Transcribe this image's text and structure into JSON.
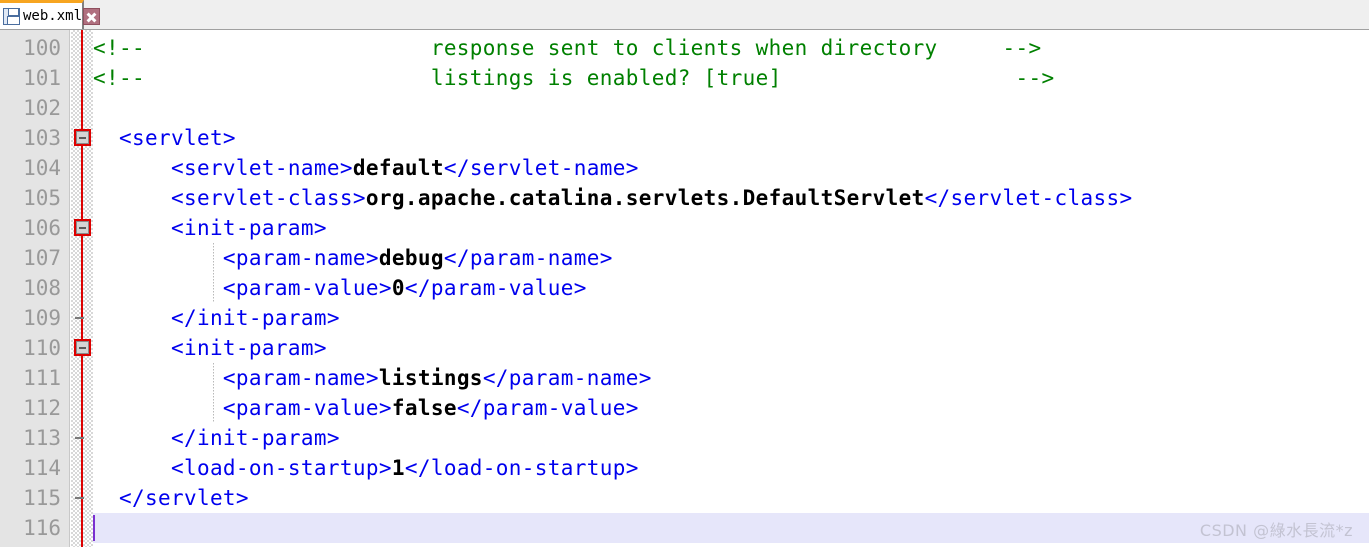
{
  "tab": {
    "title": "web.xml",
    "save_icon": "floppy-disk-icon",
    "close_icon": "close-x-icon"
  },
  "editor": {
    "first_line_number": 100,
    "last_line_number": 116,
    "current_line": 116,
    "line_numbers": [
      "100",
      "101",
      "102",
      "103",
      "104",
      "105",
      "106",
      "107",
      "108",
      "109",
      "110",
      "111",
      "112",
      "113",
      "114",
      "115",
      "116"
    ],
    "lines": [
      {
        "n": "100",
        "indent_cols": 0,
        "parts": [
          {
            "t": "comment",
            "s": "<!--                      response sent to clients when directory     -->"
          }
        ]
      },
      {
        "n": "101",
        "indent_cols": 0,
        "parts": [
          {
            "t": "comment",
            "s": "<!--                      listings is enabled? [true]                  -->"
          }
        ]
      },
      {
        "n": "102",
        "indent_cols": 0,
        "parts": []
      },
      {
        "n": "103",
        "indent_cols": 0,
        "parts": [
          {
            "t": "tag",
            "s": "  <servlet>"
          }
        ]
      },
      {
        "n": "104",
        "indent_cols": 0,
        "parts": [
          {
            "t": "tag",
            "s": "      <servlet-name>"
          },
          {
            "t": "val",
            "s": "default"
          },
          {
            "t": "tag",
            "s": "</servlet-name>"
          }
        ]
      },
      {
        "n": "105",
        "indent_cols": 0,
        "parts": [
          {
            "t": "tag",
            "s": "      <servlet-class>"
          },
          {
            "t": "val",
            "s": "org.apache.catalina.servlets.DefaultServlet"
          },
          {
            "t": "tag",
            "s": "</servlet-class>"
          }
        ]
      },
      {
        "n": "106",
        "indent_cols": 0,
        "parts": [
          {
            "t": "tag",
            "s": "      <init-param>"
          }
        ]
      },
      {
        "n": "107",
        "indent_cols": 0,
        "parts": [
          {
            "t": "tag",
            "s": "          <param-name>"
          },
          {
            "t": "val",
            "s": "debug"
          },
          {
            "t": "tag",
            "s": "</param-name>"
          }
        ]
      },
      {
        "n": "108",
        "indent_cols": 0,
        "parts": [
          {
            "t": "tag",
            "s": "          <param-value>"
          },
          {
            "t": "val",
            "s": "0"
          },
          {
            "t": "tag",
            "s": "</param-value>"
          }
        ]
      },
      {
        "n": "109",
        "indent_cols": 0,
        "parts": [
          {
            "t": "tag",
            "s": "      </init-param>"
          }
        ]
      },
      {
        "n": "110",
        "indent_cols": 0,
        "parts": [
          {
            "t": "tag",
            "s": "      <init-param>"
          }
        ]
      },
      {
        "n": "111",
        "indent_cols": 0,
        "parts": [
          {
            "t": "tag",
            "s": "          <param-name>"
          },
          {
            "t": "val",
            "s": "listings"
          },
          {
            "t": "tag",
            "s": "</param-name>"
          }
        ]
      },
      {
        "n": "112",
        "indent_cols": 0,
        "parts": [
          {
            "t": "tag",
            "s": "          <param-value>"
          },
          {
            "t": "val",
            "s": "false"
          },
          {
            "t": "tag",
            "s": "</param-value>"
          }
        ]
      },
      {
        "n": "113",
        "indent_cols": 0,
        "parts": [
          {
            "t": "tag",
            "s": "      </init-param>"
          }
        ]
      },
      {
        "n": "114",
        "indent_cols": 0,
        "parts": [
          {
            "t": "tag",
            "s": "      <load-on-startup>"
          },
          {
            "t": "val",
            "s": "1"
          },
          {
            "t": "tag",
            "s": "</load-on-startup>"
          }
        ]
      },
      {
        "n": "115",
        "indent_cols": 0,
        "parts": [
          {
            "t": "tag",
            "s": "  </servlet>"
          }
        ]
      },
      {
        "n": "116",
        "indent_cols": 0,
        "parts": []
      }
    ],
    "fold_markers": [
      {
        "line": "103",
        "type": "collapse-box"
      },
      {
        "line": "106",
        "type": "collapse-box"
      },
      {
        "line": "109",
        "type": "end-tick"
      },
      {
        "line": "110",
        "type": "collapse-box"
      },
      {
        "line": "113",
        "type": "end-tick"
      },
      {
        "line": "115",
        "type": "end-tick"
      }
    ],
    "indent_guides": [
      {
        "start_line": "107",
        "end_line": "108",
        "col": 8
      },
      {
        "start_line": "111",
        "end_line": "112",
        "col": 8
      }
    ],
    "colors": {
      "tag": "#0000ee",
      "value": "#000000",
      "comment": "#008000",
      "gutter_bg": "#e4e4e4",
      "line_number": "#999999",
      "fold_line": "#dd0000",
      "current_line_bg": "#e6e6fa",
      "caret": "#7a2fd0",
      "tab_active_border": "#f7a520"
    }
  },
  "watermark": {
    "text": "CSDN @綠水長流*z"
  }
}
